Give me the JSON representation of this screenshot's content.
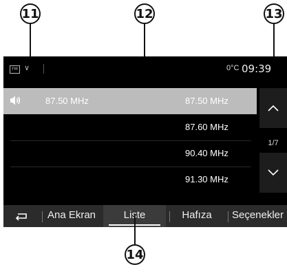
{
  "callouts": {
    "c11": "11",
    "c12": "12",
    "c13": "13",
    "c14": "14"
  },
  "status": {
    "source_badge": "FM",
    "source_chevron": "∨",
    "temperature": "0°C",
    "clock": "09:39"
  },
  "stations": [
    {
      "name": "87.50 MHz",
      "freq": "87.50 MHz",
      "selected": true,
      "icon": "speaker-icon"
    },
    {
      "name": "",
      "freq": "87.60 MHz",
      "selected": false
    },
    {
      "name": "",
      "freq": "90.40 MHz",
      "selected": false
    },
    {
      "name": "",
      "freq": "91.30 MHz",
      "selected": false
    }
  ],
  "scroll": {
    "page_indicator": "1/7",
    "up_icon": "chevron-up-icon",
    "down_icon": "chevron-down-icon"
  },
  "tabs": {
    "back_icon": "back-arrow-icon",
    "home": "Ana Ekran",
    "list": "Liste",
    "memory": "Hafıza",
    "options": "Seçenekler"
  }
}
